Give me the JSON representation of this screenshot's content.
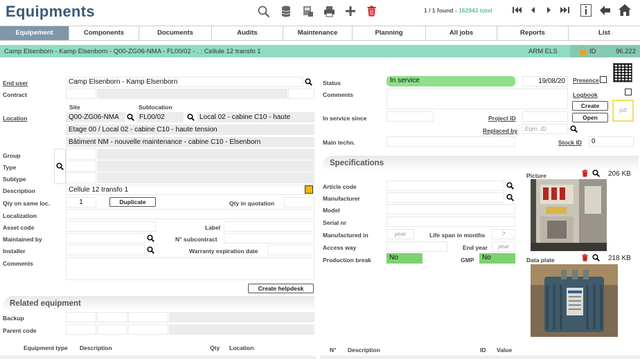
{
  "app": {
    "title": "Equipments"
  },
  "toolbar": {
    "found": "1 / 1 found - ",
    "total": "162943 total"
  },
  "tabs": [
    "Equipement",
    "Components",
    "Documents",
    "Audits",
    "Maintenance",
    "Planning",
    "All jobs",
    "Reports",
    "List"
  ],
  "breadcrumb": {
    "path": "Camp Elsenborn - Kamp Elsenborn - Q00-ZG06-NMA - FL00/02 - . : Cellule 12 transfo 1",
    "org": "ARM ELS",
    "id_label": "ID",
    "id_value": "96.222"
  },
  "form": {
    "end_user_label": "End user",
    "end_user": "Camp Elsenborn - Kamp Elsenborn",
    "contract_label": "Contract",
    "site_label": "Site",
    "sublocation_label": "Sublocation",
    "location_label": "Location",
    "site": "Q00-ZG06-NMA",
    "sublocation": "FL00/02",
    "loc_desc1": "Local 02 - cabine C10 - haute",
    "loc_desc2": "Etage 00 / Local 02 - cabine C10 - haute tension",
    "loc_desc3": "Bâtiment NM - nouvelle maintenance - cabine C10 - Elsenborn",
    "group_label": "Group",
    "type_label": "Type",
    "subtype_label": "Subtype",
    "description_label": "Description",
    "description": "Cellule 12 transfo 1",
    "qty_label": "Qty on same loc.",
    "qty": "1",
    "duplicate": "Duplicate",
    "qty_quotation_label": "Qty in quotation",
    "localization_label": "Localization",
    "asset_label": "Asset code",
    "label_label": "Label",
    "maintained_label": "Maintained by",
    "subcontract_label": "N° subcontract",
    "installer_label": "Installer",
    "warranty_label": "Warranty expiration date",
    "comments_label": "Comments",
    "helpdesk": "Create helpdesk"
  },
  "related": {
    "title": "Related equipment",
    "backup_label": "Backup",
    "parent_label": "Parent code",
    "columns": [
      "Equipment type",
      "Description",
      "Qty",
      "Location"
    ]
  },
  "right": {
    "status_label": "Status",
    "status": "In service",
    "date": "19/08/20",
    "presence_label": "Presence",
    "logbook_label": "Logbook",
    "create": "Create",
    "open": "Open",
    "pdf": "pdf",
    "comments_label": "Comments",
    "in_service_label": "In service since",
    "project_label": "Project ID",
    "replaced_label": "Replaced by",
    "eqm_placeholder": "Eqm. ID",
    "main_techn_label": "Main techn.",
    "stock_label": "Stock ID",
    "stock": "0"
  },
  "specs": {
    "title": "Specifications",
    "article_label": "Article code",
    "manufacturer_label": "Manufacturer",
    "model_label": "Model",
    "serial_label": "Serial nr",
    "manufactured_label": "Manufactured in",
    "year_placeholder": "year",
    "lifespan_label": "Life span in months",
    "lifespan_placeholder": "?",
    "access_label": "Access way",
    "endyear_label": "End year",
    "endyear_placeholder": "year",
    "prodbreak_label": "Production break",
    "prodbreak": "No",
    "gmp_label": "GMP",
    "gmp": "No",
    "columns": [
      "N°",
      "Description",
      "ID",
      "Value"
    ]
  },
  "picture": {
    "label": "Picture",
    "size": "206 KB"
  },
  "dataplate": {
    "label": "Data plate",
    "size": "218 KB"
  },
  "colors": {
    "accent": "#3b5a7a",
    "breadcrumb_bg": "#8fdcc3",
    "status_green": "#8fe08a",
    "no_green": "#7cd36e",
    "delete_red": "#d11f1f",
    "lock_orange": "#f0a020"
  }
}
